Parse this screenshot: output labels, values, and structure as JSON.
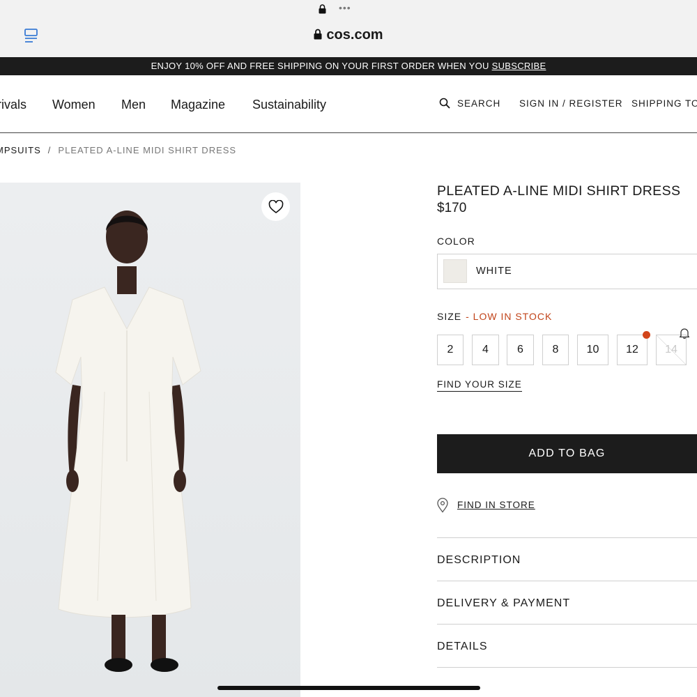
{
  "browser": {
    "url": "cos.com",
    "tabs_icon": "tabs-icon",
    "menu_dots": "•••"
  },
  "promo": {
    "text": "ENJOY 10% OFF AND FREE SHIPPING ON YOUR FIRST ORDER WHEN YOU ",
    "link": "SUBSCRIBE"
  },
  "nav": {
    "items": [
      "rivals",
      "Women",
      "Men",
      "Magazine",
      "Sustainability"
    ],
    "search": "SEARCH",
    "sign_in": "SIGN IN / REGISTER",
    "shipping": "SHIPPING TO"
  },
  "breadcrumb": {
    "parent": "MPSUITS",
    "separator": "/",
    "current": "PLEATED A-LINE MIDI SHIRT DRESS"
  },
  "product": {
    "title": "PLEATED A-LINE MIDI SHIRT DRESS",
    "price": "$170",
    "color_label": "COLOR",
    "color_value": "WHITE",
    "swatch_color": "#eeece7",
    "size_label": "SIZE",
    "stock_note": "- LOW IN STOCK",
    "sizes": [
      "2",
      "4",
      "6",
      "8",
      "10",
      "12",
      "14"
    ],
    "low_stock_indicator_color": "#d2451a",
    "find_size": "FIND YOUR SIZE",
    "add_to_bag": "ADD TO BAG",
    "find_in_store": "FIND IN STORE",
    "accordion": [
      "DESCRIPTION",
      "DELIVERY & PAYMENT",
      "DETAILS"
    ]
  }
}
